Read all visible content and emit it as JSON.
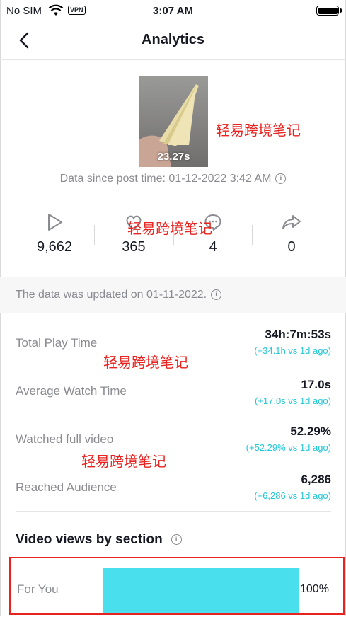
{
  "status_bar": {
    "carrier": "No SIM",
    "vpn": "VPN",
    "time": "3:07 AM"
  },
  "header": {
    "title": "Analytics"
  },
  "video": {
    "duration": "23.27s",
    "data_since": "Data since post time: 01-12-2022 3:42 AM"
  },
  "watermark": "轻易跨境笔记",
  "stats": [
    {
      "icon": "play-icon",
      "value": "9,662"
    },
    {
      "icon": "heart-icon",
      "value": "365"
    },
    {
      "icon": "comment-icon",
      "value": "4"
    },
    {
      "icon": "share-icon",
      "value": "0"
    }
  ],
  "banner": {
    "text": "The data was updated on 01-11-2022."
  },
  "metrics": [
    {
      "label": "Total Play Time",
      "value": "34h:7m:53s",
      "change": "(+34.1h vs 1d ago)"
    },
    {
      "label": "Average Watch Time",
      "value": "17.0s",
      "change": "(+17.0s vs 1d ago)"
    },
    {
      "label": "Watched full video",
      "value": "52.29%",
      "change": "(+52.29% vs 1d ago)"
    },
    {
      "label": "Reached Audience",
      "value": "6,286",
      "change": "(+6,286 vs 1d ago)"
    }
  ],
  "views_by_section": {
    "title": "Video views by section",
    "rows": [
      {
        "label": "For You",
        "percent_text": "100%",
        "fraction": 1.0
      }
    ]
  },
  "colors": {
    "accent_cyan": "#20c7d8",
    "bar_fill": "#4adfed",
    "watermark_red": "#e8231f"
  }
}
